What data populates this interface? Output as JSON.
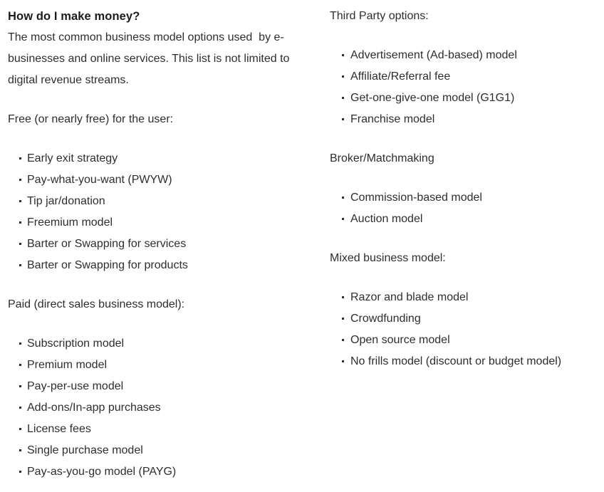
{
  "document": {
    "heading": "How do I make money?",
    "intro": "The most common business model options used  by e-businesses and online services. This list is not limited to digital revenue streams.",
    "text_color": "#2e2e2e",
    "heading_color": "#1c1c1c",
    "background_color": "#ffffff",
    "bullet_glyph": "square-dot"
  },
  "left_column": {
    "sections": [
      {
        "heading": "Free (or nearly free) for the user:",
        "items": [
          "Early exit strategy",
          "Pay-what-you-want (PWYW)",
          "Tip jar/donation",
          "Freemium model",
          "Barter or Swapping for services",
          "Barter or Swapping for products"
        ]
      },
      {
        "heading": "Paid (direct sales business model):",
        "items": [
          "Subscription model",
          "Premium model",
          "Pay-per-use model",
          "Add-ons/In-app purchases",
          "License fees",
          "Single purchase model",
          "Pay-as-you-go model (PAYG)"
        ]
      }
    ]
  },
  "right_column": {
    "sections": [
      {
        "heading": "Third Party options:",
        "items": [
          "Advertisement (Ad-based) model",
          "Affiliate/Referral fee",
          "Get-one-give-one model (G1G1)",
          "Franchise model"
        ]
      },
      {
        "heading": "Broker/Matchmaking",
        "items": [
          "Commission-based model",
          "Auction model"
        ]
      },
      {
        "heading": "Mixed business model:",
        "items": [
          "Razor and blade model",
          "Crowdfunding",
          "Open source model",
          "No frills model (discount or budget model)"
        ]
      }
    ]
  }
}
